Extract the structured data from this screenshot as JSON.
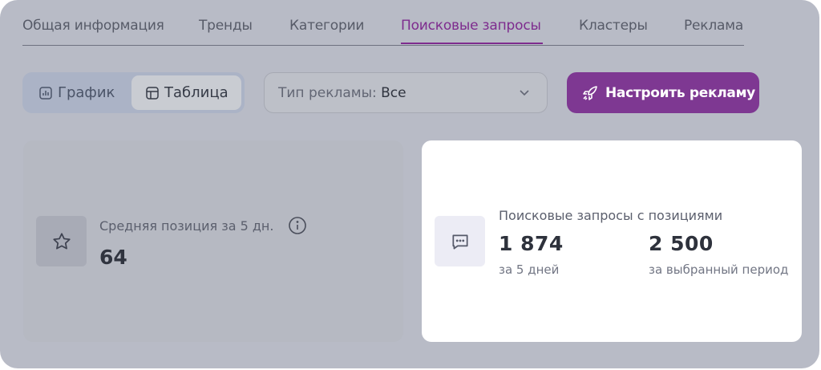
{
  "tabs": [
    {
      "label": "Общая информация"
    },
    {
      "label": "Тренды"
    },
    {
      "label": "Категории"
    },
    {
      "label": "Поисковые запросы"
    },
    {
      "label": "Кластеры"
    },
    {
      "label": "Реклама"
    }
  ],
  "active_tab": "Поисковые запросы",
  "view_toggle": {
    "chart_label": "График",
    "table_label": "Таблица",
    "selected": "Таблица"
  },
  "ad_type_select": {
    "label": "Тип рекламы:",
    "value": "Все"
  },
  "configure_ads_button": {
    "label": "Настроить рекламу"
  },
  "avg_position_card": {
    "label": "Средняя позиция за 5 дн.",
    "value": "64"
  },
  "queries_card": {
    "label": "Поисковые запросы с позициями",
    "value_5d": "1 874",
    "caption_5d": "за 5 дней",
    "value_period": "2 500",
    "caption_period": "за выбранный период"
  },
  "colors": {
    "accent": "#7e3892",
    "overlay": "#b8bbc6",
    "active_card": "#ffffff"
  }
}
